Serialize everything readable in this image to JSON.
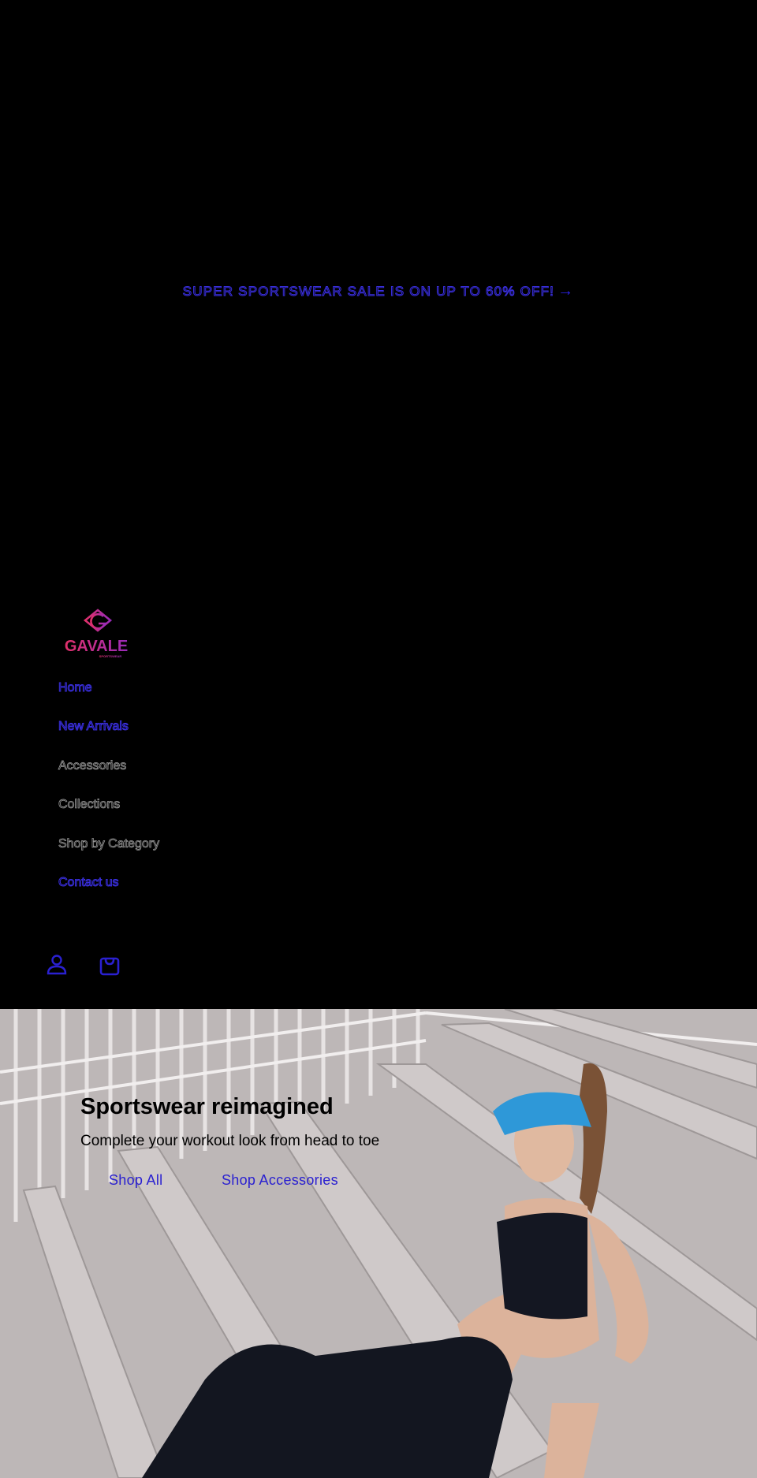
{
  "announcement": {
    "text": "SUPER SPORTSWEAR SALE IS ON UP TO 60% OFF!",
    "arrow_icon": "arrow-right-icon"
  },
  "header": {
    "logo": {
      "text": "GAVALE",
      "subtext": "SPORTSWEAR",
      "colors": [
        "#e0306a",
        "#9a2bb8"
      ]
    },
    "nav": [
      {
        "label": "Home"
      },
      {
        "label": "New Arrivals"
      },
      {
        "label": "Accessories"
      },
      {
        "label": "Collections"
      },
      {
        "label": "Shop by Category"
      },
      {
        "label": "Contact us"
      }
    ],
    "icons": [
      "account-icon",
      "cart-icon"
    ]
  },
  "hero": {
    "title": "Sportswear reimagined",
    "subtitle": "Complete your workout look from head to toe",
    "buttons": [
      {
        "label": "Shop All"
      },
      {
        "label": "Shop Accessories"
      }
    ],
    "background_image": "woman-on-bleachers-sportswear-photo"
  },
  "colors": {
    "background": "#000000",
    "link": "#2a20d0",
    "accent": "#3a2fe0"
  }
}
